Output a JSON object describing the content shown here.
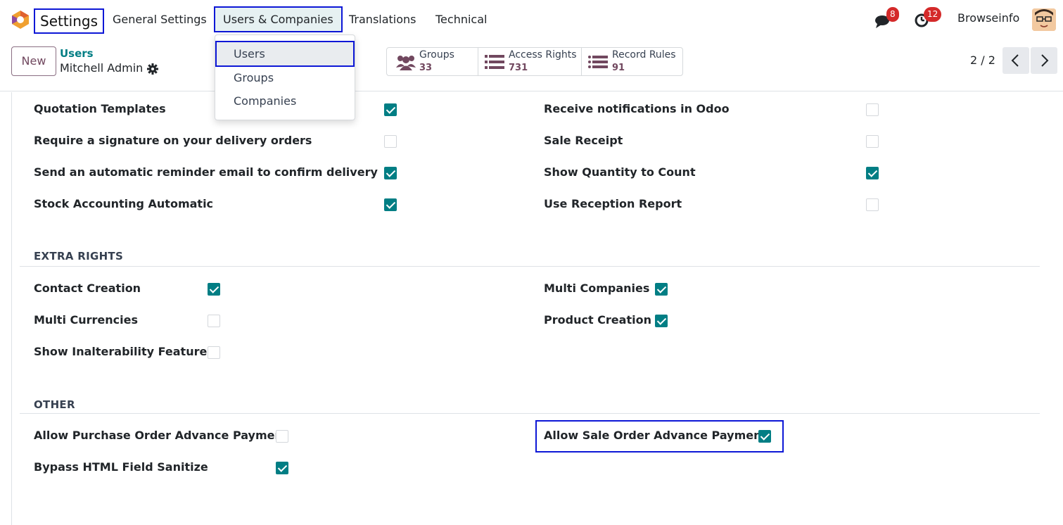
{
  "navbar": {
    "app_name": "Settings",
    "menu": [
      "General Settings",
      "Users & Companies",
      "Translations",
      "Technical"
    ],
    "messages_count": "8",
    "activities_count": "12",
    "user_name": "Browseinfo"
  },
  "dropdown": {
    "items": [
      "Users",
      "Groups",
      "Companies"
    ]
  },
  "control_panel": {
    "new_label": "New",
    "breadcrumb_parent": "Users",
    "breadcrumb_current": "Mitchell Admin",
    "stats": [
      {
        "label": "Groups",
        "value": "33",
        "icon": "users-icon"
      },
      {
        "label": "Access Rights",
        "value": "731",
        "icon": "list-icon"
      },
      {
        "label": "Record Rules",
        "value": "91",
        "icon": "list-icon"
      }
    ],
    "pager": "2 / 2"
  },
  "permissions": {
    "left": [
      {
        "label": "Quotation Templates",
        "checked": true
      },
      {
        "label": "Require a signature on your delivery orders",
        "checked": false
      },
      {
        "label": "Send an automatic reminder email to confirm delivery",
        "checked": true
      },
      {
        "label": "Stock Accounting Automatic",
        "checked": true
      }
    ],
    "right": [
      {
        "label": "Receive notifications in Odoo",
        "checked": false
      },
      {
        "label": "Sale Receipt",
        "checked": false
      },
      {
        "label": "Show Quantity to Count",
        "checked": true
      },
      {
        "label": "Use Reception Report",
        "checked": false
      }
    ]
  },
  "extra_rights": {
    "title": "EXTRA RIGHTS",
    "left": [
      {
        "label": "Contact Creation",
        "checked": true
      },
      {
        "label": "Multi Currencies",
        "checked": false
      },
      {
        "label": "Show Inalterability Features",
        "checked": false
      }
    ],
    "right": [
      {
        "label": "Multi Companies",
        "checked": true
      },
      {
        "label": "Product Creation",
        "checked": true
      }
    ]
  },
  "other": {
    "title": "OTHER",
    "left": [
      {
        "label": "Allow Purchase Order Advance Payment",
        "checked": false
      },
      {
        "label": "Bypass HTML Field Sanitize",
        "checked": true
      }
    ],
    "right": [
      {
        "label": "Allow Sale Order Advance Payment",
        "checked": true
      }
    ]
  },
  "colors": {
    "accent": "#017e84",
    "brand": "#71485f",
    "highlight": "#0d17d6",
    "badge": "#d42a2a"
  }
}
